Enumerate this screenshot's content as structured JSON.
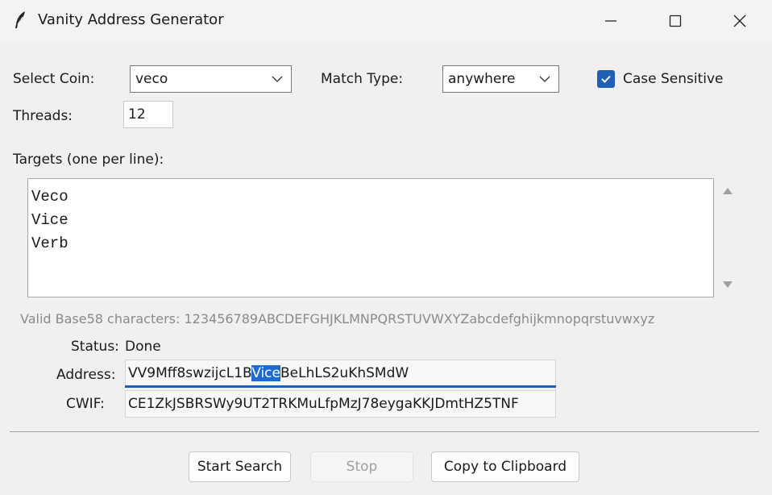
{
  "window": {
    "title": "Vanity Address Generator",
    "icon": "feather-icon",
    "controls": [
      "minimize-icon",
      "maximize-icon",
      "close-icon"
    ]
  },
  "form": {
    "coin_label": "Select Coin:",
    "coin_value": "veco",
    "match_type_label": "Match Type:",
    "match_type_value": "anywhere",
    "case_sensitive_label": "Case Sensitive",
    "case_sensitive_checked": true,
    "threads_label": "Threads:",
    "threads_value": "12",
    "targets_label": "Targets (one per line):",
    "targets": [
      "Veco",
      "Vice",
      "Verb"
    ],
    "hint": "Valid Base58 characters: 123456789ABCDEFGHJKLMNPQRSTUVWXYZabcdefghijkmnopqrstuvwxyz"
  },
  "result": {
    "status_label": "Status:",
    "status_value": "Done",
    "address_label": "Address:",
    "address_prefix": "VV9Mff8swzijcL1B",
    "address_match": "Vice",
    "address_suffix": "BeLhLS2uKhSMdW",
    "cwif_label": "CWIF:",
    "cwif_value": "CE1ZkJSBRSWy9UT2TRKMuLfpMzJ78eygaKKJDmtHZ5TNF"
  },
  "buttons": {
    "start": "Start Search",
    "stop": "Stop",
    "copy": "Copy to Clipboard"
  },
  "colors": {
    "accent": "#1f5fb8",
    "selection": "#1e6ad0",
    "hint_text": "#8a8a8a"
  }
}
